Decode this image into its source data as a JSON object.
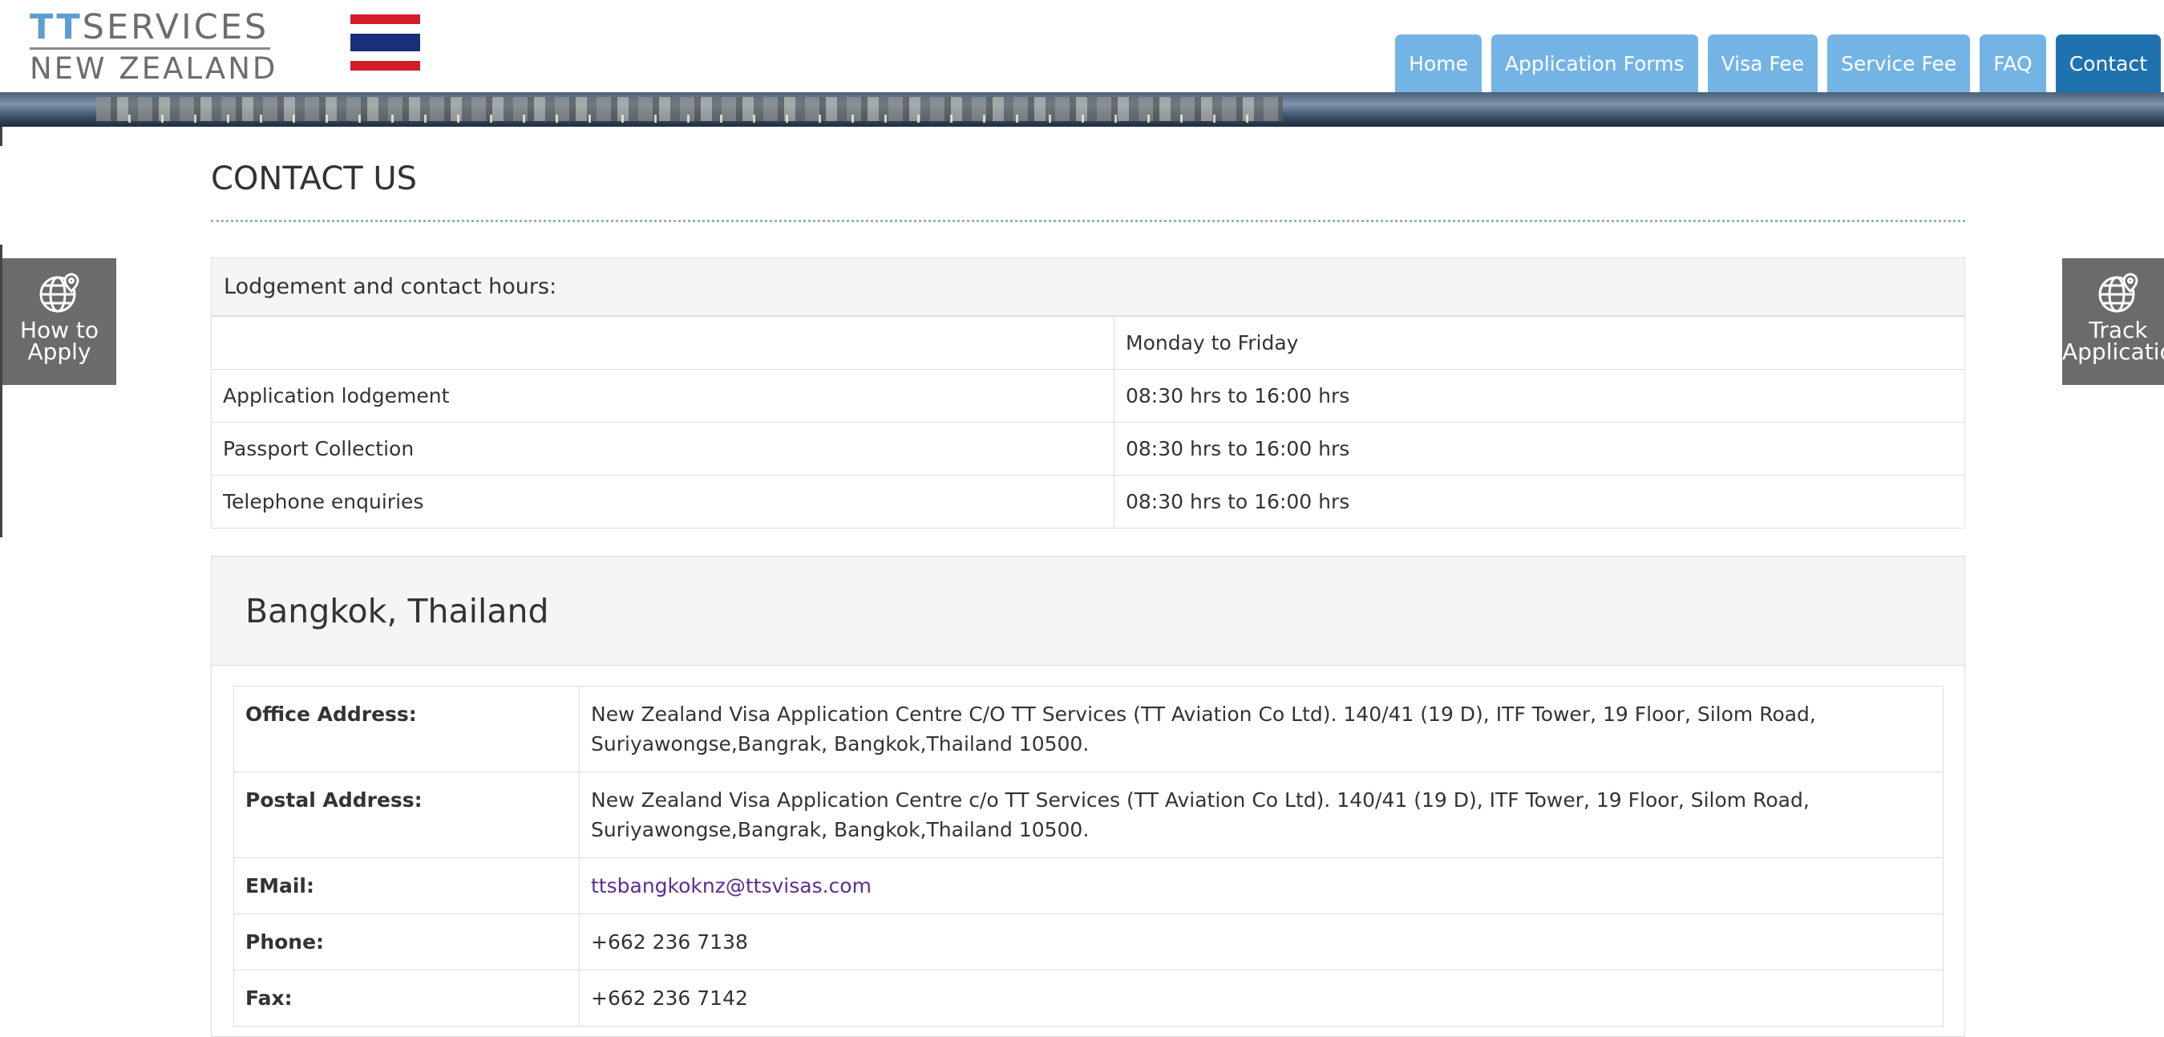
{
  "logo": {
    "part1": "TT",
    "part2": "SERVICES",
    "line2": "NEW ZEALAND"
  },
  "flag": {
    "colors": [
      "#d31d2a",
      "#ffffff",
      "#1a2f7a",
      "#ffffff",
      "#d31d2a"
    ]
  },
  "nav": [
    {
      "label": "Home",
      "active": false
    },
    {
      "label": "Application Forms",
      "active": false
    },
    {
      "label": "Visa Fee",
      "active": false
    },
    {
      "label": "Service Fee",
      "active": false
    },
    {
      "label": "FAQ",
      "active": false
    },
    {
      "label": "Contact",
      "active": true
    }
  ],
  "side_tabs": {
    "left": {
      "line1": "How to",
      "line2": "Apply",
      "icon": "globe-pin-icon"
    },
    "right": {
      "line1": "Track",
      "line2": "Application",
      "icon": "globe-pin-icon"
    }
  },
  "page": {
    "title": "CONTACT US"
  },
  "hours": {
    "heading": "Lodgement and contact hours:",
    "rows": [
      {
        "label": "",
        "value": "Monday to Friday"
      },
      {
        "label": "Application lodgement",
        "value": "08:30 hrs to 16:00 hrs"
      },
      {
        "label": "Passport Collection",
        "value": "08:30 hrs to 16:00 hrs"
      },
      {
        "label": "Telephone enquiries",
        "value": "08:30 hrs to 16:00 hrs"
      }
    ]
  },
  "office": {
    "city": "Bangkok, Thailand",
    "rows": [
      {
        "label": "Office Address:",
        "value": "New Zealand Visa Application Centre C/O TT Services (TT Aviation Co Ltd). 140/41 (19 D), ITF Tower, 19 Floor, Silom Road, Suriyawongse,Bangrak, Bangkok,Thailand 10500."
      },
      {
        "label": "Postal Address:",
        "value": "New Zealand Visa Application Centre c/o TT Services (TT Aviation Co Ltd). 140/41 (19 D), ITF Tower, 19 Floor, Silom Road, Suriyawongse,Bangrak, Bangkok,Thailand 10500."
      },
      {
        "label": "EMail:",
        "value": "ttsbangkoknz@ttsvisas.com"
      },
      {
        "label": "Phone:",
        "value": "+662 236 7138"
      },
      {
        "label": "Fax:",
        "value": "+662 236 7142"
      }
    ]
  },
  "colors": {
    "nav": "#74b4e5",
    "nav_active": "#1f72b0",
    "side_tab": "#6b6b6b",
    "link": "#5c2d91"
  }
}
